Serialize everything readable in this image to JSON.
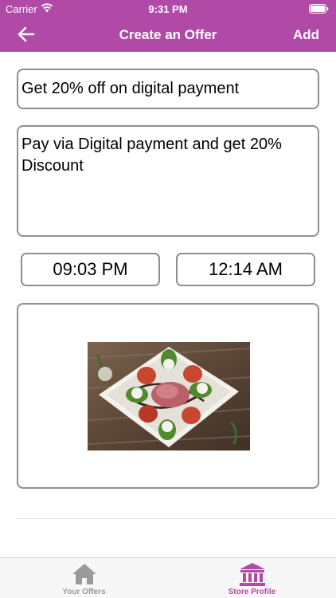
{
  "status_bar": {
    "carrier": "Carrier",
    "time": "9:31 PM",
    "icons": [
      "wifi-icon",
      "battery-icon"
    ]
  },
  "nav": {
    "title": "Create an Offer",
    "back_icon": "arrow-left-icon",
    "add_label": "Add",
    "background_color": "#b14aa6"
  },
  "form": {
    "offer_title": "Get 20% off on digital payment",
    "offer_description": "Pay via Digital payment and get 20% Discount",
    "start_time": "09:03 PM",
    "end_time": "12:14 AM",
    "image_content": "food-platter-photo"
  },
  "tab_bar": {
    "tabs": [
      {
        "label": "Your Offers",
        "icon": "house-icon",
        "selected": false
      },
      {
        "label": "Store Profile",
        "icon": "bank-building-icon",
        "selected": true
      }
    ],
    "active_color": "#b14aa6",
    "inactive_color": "#9a9a9a"
  }
}
